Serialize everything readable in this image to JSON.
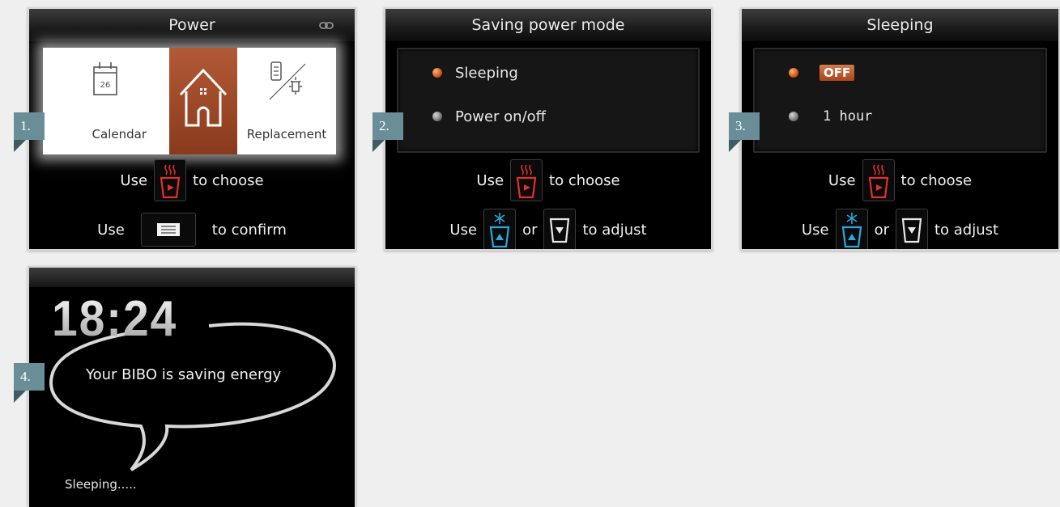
{
  "panels": [
    {
      "step": "1.",
      "title": "Power",
      "menu": {
        "calendar_day": "26",
        "calendar_label": "Calendar",
        "replacement_label": "Replacement"
      },
      "instructions": {
        "use1": "Use",
        "choose": "to choose",
        "use2": "Use",
        "confirm": "to confirm"
      }
    },
    {
      "step": "2.",
      "title": "Saving power mode",
      "options": [
        {
          "label": "Sleeping",
          "selected": true
        },
        {
          "label": "Power on/off",
          "selected": false
        }
      ],
      "instructions": {
        "use1": "Use",
        "choose": "to choose",
        "use2": "Use",
        "or": "or",
        "adjust": "to adjust"
      }
    },
    {
      "step": "3.",
      "title": "Sleeping",
      "options": [
        {
          "label": "OFF",
          "selected": true
        },
        {
          "label": "1 hour",
          "selected": false
        }
      ],
      "instructions": {
        "use1": "Use",
        "choose": "to choose",
        "use2": "Use",
        "or": "or",
        "adjust": "to adjust"
      }
    },
    {
      "step": "4.",
      "clock": "18:24",
      "message": "Your BIBO is saving energy",
      "status": "Sleeping....."
    }
  ],
  "colors": {
    "accent_red": "#e0302a",
    "accent_blue": "#2aa6e0",
    "step_tag": "#6a8e97",
    "selected_orange": "#c4622f"
  },
  "icons": [
    "calendar-icon",
    "home-icon",
    "replacement-icon",
    "heat-button-icon",
    "menu-button-icon",
    "cold-up-button-icon",
    "down-button-icon"
  ]
}
